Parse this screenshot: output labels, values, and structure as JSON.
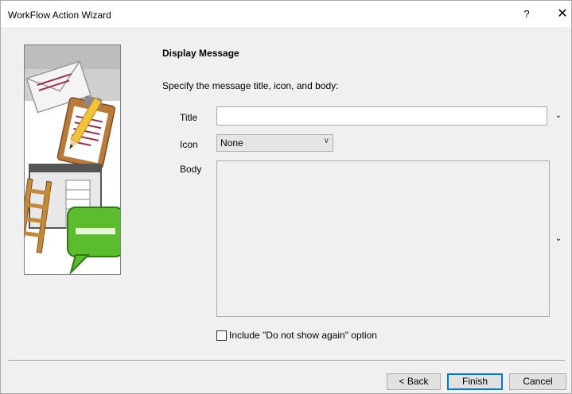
{
  "window": {
    "title": "WorkFlow Action Wizard",
    "help_glyph": "?",
    "close_glyph": "✕"
  },
  "page": {
    "heading": "Display Message",
    "instruction": "Specify the message title, icon, and body:"
  },
  "fields": {
    "title_label": "Title",
    "title_value": "",
    "icon_label": "Icon",
    "icon_value": "None",
    "body_label": "Body",
    "body_value": ""
  },
  "icons": {
    "title_insert": "chevron-down-icon",
    "body_insert": "chevron-down-icon",
    "select_arrow": "chevron-down-icon",
    "scroll_up": "triangle-up-icon",
    "scroll_down": "triangle-down-icon"
  },
  "options": {
    "include_do_not_show": "Include \"Do not show again\" option",
    "include_do_not_show_checked": false
  },
  "buttons": {
    "back": "< Back",
    "finish": "Finish",
    "cancel": "Cancel"
  },
  "colors": {
    "accent": "#0078d7",
    "window_bg": "#f0f0f0"
  }
}
